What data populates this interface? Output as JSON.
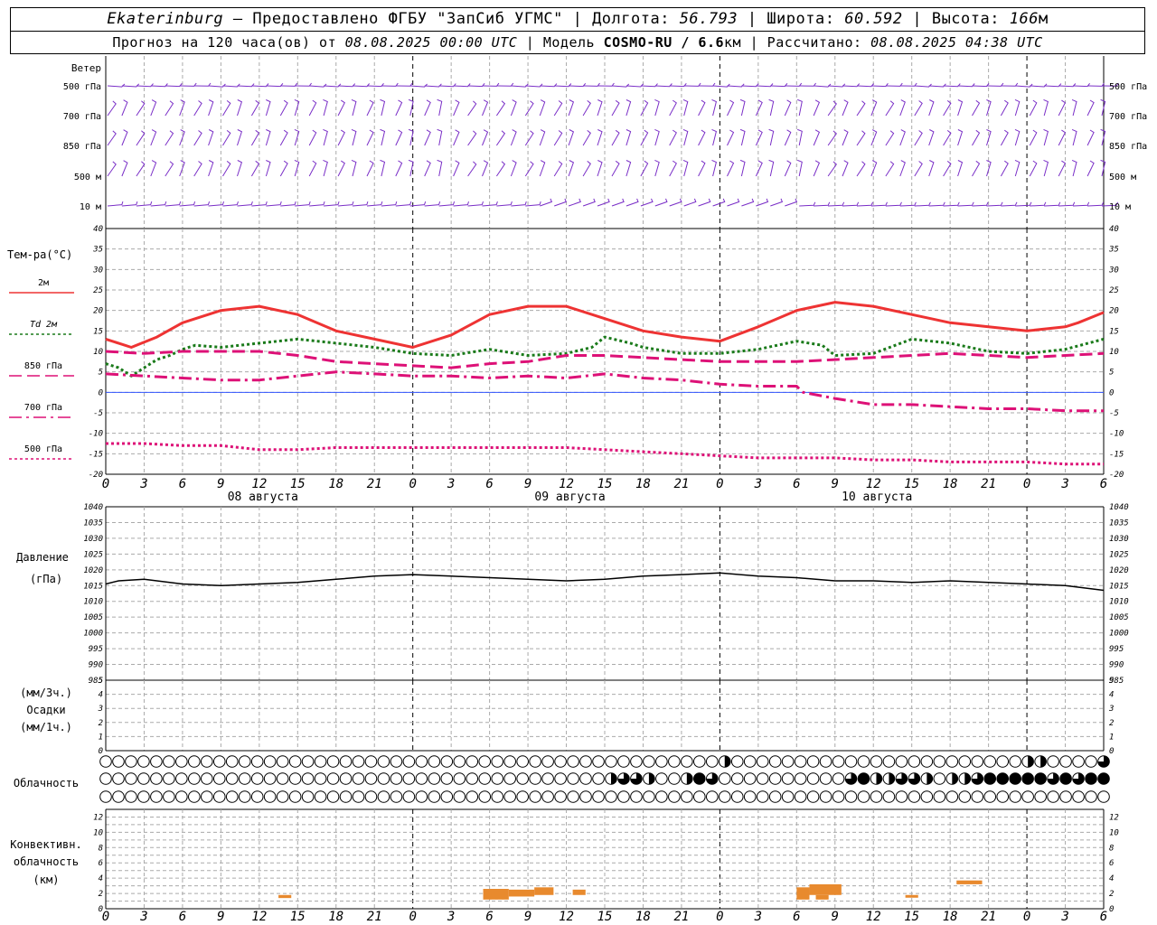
{
  "header": {
    "station": "Ekaterinburg",
    "provider": " – Предоставлено ФГБУ \"ЗапСиб УГМС\" | Долгота: ",
    "lon": "56.793",
    "lat_label": " | Широта: ",
    "lat": "60.592",
    "alt_label": " | Высота: ",
    "alt": "166",
    "alt_unit": "м",
    "forecast_prefix": "Прогноз на 120 часа(ов) от ",
    "forecast_time": "08.08.2025 00:00 UTC",
    "model_label": "  | Модель ",
    "model": "COSMO-RU / 6.6",
    "model_unit": "км",
    "calc_label": " | Рассчитано: ",
    "calc_time": "08.08.2025 04:38 UTC"
  },
  "x_ticks": [
    "0",
    "3",
    "6",
    "9",
    "12",
    "15",
    "18",
    "21",
    "0",
    "3",
    "6",
    "9",
    "12",
    "15",
    "18",
    "21",
    "0",
    "3",
    "6",
    "9",
    "12",
    "15",
    "18",
    "21",
    "0",
    "3",
    "6"
  ],
  "day_labels": [
    {
      "hour": 12,
      "text": "08 августа"
    },
    {
      "hour": 36,
      "text": "09 августа"
    },
    {
      "hour": 60,
      "text": "10 августа"
    }
  ],
  "wind": {
    "title": "Ветер",
    "levels": [
      "500 гПа",
      "700 гПа",
      "850 гПа",
      "500 м",
      "10 м"
    ],
    "color": "#7a2fc7"
  },
  "temperature": {
    "title": "Тем-ра(°С)",
    "legend": [
      {
        "label": "2м",
        "color": "#ee3333",
        "style": "solid"
      },
      {
        "label": "Td 2м",
        "color": "#1a7a1a",
        "style": "dot"
      },
      {
        "label": "850 гПа",
        "color": "#dd1177",
        "style": "dash"
      },
      {
        "label": "700 гПа",
        "color": "#dd1177",
        "style": "dashdot"
      },
      {
        "label": "500 гПа",
        "color": "#dd1177",
        "style": "dot"
      }
    ],
    "y_ticks": [
      "40",
      "35",
      "30",
      "25",
      "20",
      "15",
      "10",
      "5",
      "0",
      "-5",
      "-10",
      "-15",
      "-20"
    ]
  },
  "pressure": {
    "title": "Давление",
    "unit": "(гПа)",
    "y_ticks": [
      "1040",
      "1035",
      "1030",
      "1025",
      "1020",
      "1015",
      "1010",
      "1005",
      "1000",
      "995",
      "990",
      "985"
    ]
  },
  "precip": {
    "title_a": "(мм/3ч.)",
    "title_b": "Осадки",
    "title_c": "(мм/1ч.)",
    "y_ticks": [
      "5",
      "4",
      "3",
      "2",
      "1",
      "0"
    ]
  },
  "cloud": {
    "title": "Облачность"
  },
  "convective": {
    "title_a": "Конвективн.",
    "title_b": "облачность",
    "title_c": "(км)",
    "y_ticks": [
      "12",
      "10",
      "8",
      "6",
      "4",
      "2",
      "0"
    ],
    "color": "#e88a2e"
  },
  "chart_data": [
    {
      "type": "line",
      "title": "Тем-ра(°С)",
      "x_unit": "hours from 08.08.2025 00:00 UTC",
      "ylim": [
        -20,
        40
      ],
      "series": [
        {
          "name": "2м",
          "x": [
            0,
            2,
            4,
            6,
            9,
            12,
            15,
            18,
            21,
            24,
            27,
            30,
            33,
            36,
            39,
            42,
            45,
            48,
            51,
            54,
            57,
            60,
            63,
            66,
            69,
            72,
            75,
            76,
            78
          ],
          "values": [
            13,
            11,
            13.5,
            17,
            20,
            21,
            19,
            15,
            13,
            11,
            14,
            19,
            21,
            21,
            18,
            15,
            13.5,
            12.5,
            16,
            20,
            22,
            21,
            19,
            17,
            16,
            15,
            16,
            17,
            19.5
          ]
        },
        {
          "name": "Td 2м",
          "x": [
            0,
            1,
            2,
            3,
            4,
            5,
            6,
            7,
            9,
            12,
            15,
            18,
            21,
            24,
            27,
            30,
            33,
            36,
            38,
            39,
            41,
            42,
            45,
            48,
            51,
            54,
            56,
            57,
            60,
            63,
            66,
            69,
            72,
            75,
            78
          ],
          "values": [
            7,
            6,
            4,
            6,
            8,
            9,
            10.5,
            11.5,
            11,
            12,
            13,
            12,
            11,
            9.5,
            9,
            10.5,
            9,
            9.5,
            11,
            13.5,
            12,
            11,
            9.5,
            9.5,
            10.5,
            12.5,
            11.5,
            9,
            9.5,
            13,
            12,
            10,
            9.5,
            10.5,
            13
          ]
        },
        {
          "name": "850 гПа",
          "x": [
            0,
            3,
            6,
            9,
            12,
            15,
            18,
            21,
            24,
            27,
            30,
            33,
            36,
            39,
            42,
            45,
            48,
            51,
            54,
            57,
            60,
            63,
            66,
            69,
            72,
            75,
            78
          ],
          "values": [
            10,
            9.5,
            10,
            10,
            10,
            9,
            7.5,
            7,
            6.5,
            6,
            7,
            7.5,
            9,
            9,
            8.5,
            8,
            7.5,
            7.5,
            7.5,
            8,
            8.5,
            9,
            9.5,
            9,
            8.5,
            9,
            9.5
          ]
        },
        {
          "name": "700 гПа",
          "x": [
            0,
            3,
            6,
            9,
            12,
            15,
            18,
            21,
            24,
            27,
            30,
            33,
            36,
            39,
            42,
            45,
            48,
            51,
            54,
            54.5,
            57,
            60,
            63,
            66,
            69,
            72,
            75,
            78
          ],
          "values": [
            4.5,
            4,
            3.5,
            3,
            3,
            4,
            5,
            4.5,
            4,
            4,
            3.5,
            4,
            3.5,
            4.5,
            3.5,
            3,
            2,
            1.5,
            1.5,
            0,
            -1.5,
            -3,
            -3,
            -3.5,
            -4,
            -4,
            -4.5,
            -4.5
          ]
        },
        {
          "name": "500 гПа",
          "x": [
            0,
            3,
            6,
            9,
            12,
            15,
            18,
            21,
            24,
            27,
            30,
            33,
            36,
            39,
            42,
            45,
            48,
            51,
            54,
            57,
            60,
            63,
            66,
            69,
            72,
            75,
            78
          ],
          "values": [
            -12.5,
            -12.5,
            -13,
            -13,
            -14,
            -14,
            -13.5,
            -13.5,
            -13.5,
            -13.5,
            -13.5,
            -13.5,
            -13.5,
            -14,
            -14.5,
            -15,
            -15.5,
            -16,
            -16,
            -16,
            -16.5,
            -16.5,
            -17,
            -17,
            -17,
            -17.5,
            -17.5
          ]
        }
      ]
    },
    {
      "type": "line",
      "title": "Давление",
      "ylabel": "(гПа)",
      "ylim": [
        985,
        1040
      ],
      "series": [
        {
          "name": "",
          "x": [
            0,
            1,
            3,
            6,
            9,
            12,
            15,
            18,
            21,
            24,
            27,
            30,
            33,
            36,
            39,
            42,
            45,
            48,
            51,
            54,
            57,
            60,
            63,
            66,
            69,
            72,
            75,
            78
          ],
          "values": [
            1015.5,
            1016.5,
            1017,
            1015.5,
            1015,
            1015.5,
            1016,
            1017,
            1018,
            1018.5,
            1018,
            1017.5,
            1017,
            1016.5,
            1017,
            1018,
            1018.5,
            1019,
            1018,
            1017.5,
            1016.5,
            1016.5,
            1016,
            1016.5,
            1016,
            1015.5,
            1015,
            1013.5
          ]
        }
      ]
    },
    {
      "type": "bar",
      "title": "Осадки",
      "ylim": [
        0,
        5
      ],
      "values": []
    },
    {
      "type": "table",
      "title": "Облачность",
      "rows": [
        {
          "name": "upper",
          "cover": [
            0,
            0,
            0,
            0,
            0,
            0,
            0,
            0,
            0,
            0,
            0,
            0,
            0,
            0,
            0,
            0,
            0,
            0,
            0,
            0,
            0,
            0,
            0,
            0,
            0,
            0,
            0,
            0,
            0,
            0,
            0,
            0,
            0,
            0,
            0,
            0,
            0,
            0,
            0,
            0,
            0,
            0,
            0,
            0,
            0,
            0,
            0,
            0,
            0,
            1,
            0,
            0,
            0,
            0,
            0,
            0,
            0,
            0,
            0,
            0,
            0,
            0,
            0,
            0,
            0,
            0,
            0,
            0,
            0,
            0,
            0,
            0,
            0,
            1,
            1,
            0,
            0,
            0,
            0,
            2
          ]
        },
        {
          "name": "middle",
          "cover": [
            0,
            0,
            0,
            0,
            0,
            0,
            0,
            0,
            0,
            0,
            0,
            0,
            0,
            0,
            0,
            0,
            0,
            0,
            0,
            0,
            0,
            0,
            0,
            0,
            0,
            0,
            0,
            0,
            0,
            0,
            0,
            0,
            0,
            0,
            0,
            0,
            0,
            0,
            0,
            0,
            1,
            2,
            2,
            1,
            0,
            0,
            1,
            3,
            2,
            0,
            0,
            0,
            0,
            0,
            0,
            0,
            0,
            0,
            0,
            2,
            3,
            1,
            1,
            2,
            2,
            1,
            0,
            1,
            1,
            2,
            3,
            3,
            3,
            3,
            3,
            2,
            3,
            2,
            3,
            3
          ]
        },
        {
          "name": "lower",
          "cover": [
            0,
            0,
            0,
            0,
            0,
            0,
            0,
            0,
            0,
            0,
            0,
            0,
            0,
            0,
            0,
            0,
            0,
            0,
            0,
            0,
            0,
            0,
            0,
            0,
            0,
            0,
            0,
            0,
            0,
            0,
            0,
            0,
            0,
            0,
            0,
            0,
            0,
            0,
            0,
            0,
            0,
            0,
            0,
            0,
            0,
            0,
            0,
            0,
            0,
            0,
            0,
            0,
            0,
            0,
            0,
            0,
            0,
            0,
            0,
            0,
            0,
            0,
            0,
            0,
            0,
            0,
            0,
            0,
            0,
            0,
            0,
            0,
            0,
            0,
            0,
            0,
            0,
            0,
            0,
            0
          ]
        }
      ]
    },
    {
      "type": "bar",
      "title": "Конвективн. облачность",
      "ylabel": "(км)",
      "ylim": [
        0,
        13
      ],
      "bars": [
        {
          "x0": 13.5,
          "x1": 14.5,
          "y0": 1.4,
          "y1": 1.8
        },
        {
          "x0": 29.5,
          "x1": 31.5,
          "y0": 1.2,
          "y1": 2.6
        },
        {
          "x0": 31.5,
          "x1": 33.5,
          "y0": 1.6,
          "y1": 2.5
        },
        {
          "x0": 33.5,
          "x1": 35,
          "y0": 1.8,
          "y1": 2.8
        },
        {
          "x0": 36.5,
          "x1": 37.5,
          "y0": 1.8,
          "y1": 2.5
        },
        {
          "x0": 54,
          "x1": 55,
          "y0": 1.2,
          "y1": 2.8
        },
        {
          "x0": 55,
          "x1": 57.5,
          "y0": 1.8,
          "y1": 3.2
        },
        {
          "x0": 55.5,
          "x1": 56.5,
          "y0": 1.2,
          "y1": 1.8
        },
        {
          "x0": 62.5,
          "x1": 63.5,
          "y0": 1.5,
          "y1": 1.8
        },
        {
          "x0": 66.5,
          "x1": 68.5,
          "y0": 3.2,
          "y1": 3.7
        }
      ]
    }
  ]
}
